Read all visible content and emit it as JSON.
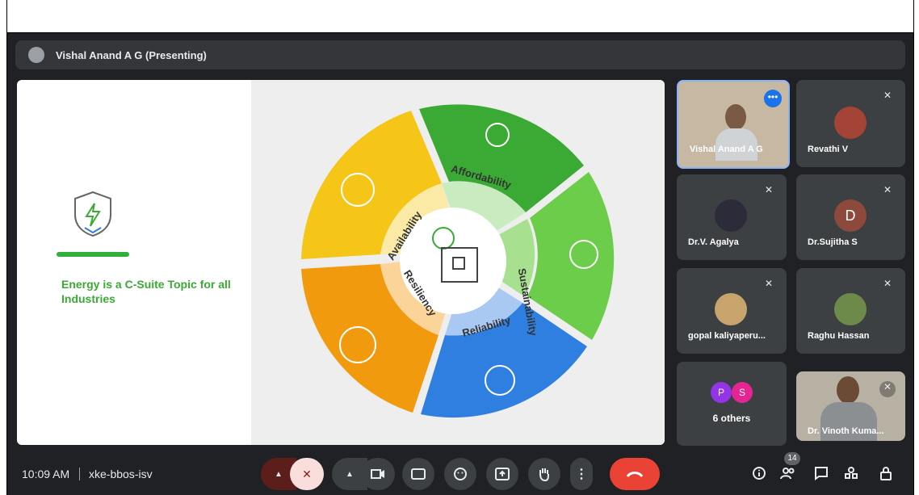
{
  "presenting": {
    "label": "Vishal Anand A G (Presenting)"
  },
  "slide": {
    "tagline": "Energy is a C-Suite Topic for all Industries",
    "segments": [
      "Affordability",
      "Sustainability",
      "Reliability",
      "Resiliency",
      "Availability"
    ],
    "colors": {
      "green": "#3aaa35",
      "yellow": "#f5c518",
      "orange": "#f29a0e",
      "blue": "#2f7fe0"
    }
  },
  "participants": [
    {
      "name": "Vishal Anand A G"
    },
    {
      "name": "Revathi V"
    },
    {
      "name": "Dr.V. Agalya"
    },
    {
      "name": "Dr.Sujitha S",
      "initial": "D"
    },
    {
      "name": "gopal kaliyaperu..."
    },
    {
      "name": "Raghu Hassan"
    },
    {
      "name": "6 others",
      "initials": [
        "P",
        "S"
      ]
    },
    {
      "name": "Dr. Vinoth Kuma..."
    }
  ],
  "meeting": {
    "time": "10:09 AM",
    "code": "xke-bbos-isv",
    "people_count": "14"
  },
  "controls": {
    "info_icon": "info-icon",
    "people_icon": "people-icon",
    "chat_icon": "chat-icon",
    "activities_icon": "activities-icon",
    "host_controls_icon": "lock-icon"
  }
}
